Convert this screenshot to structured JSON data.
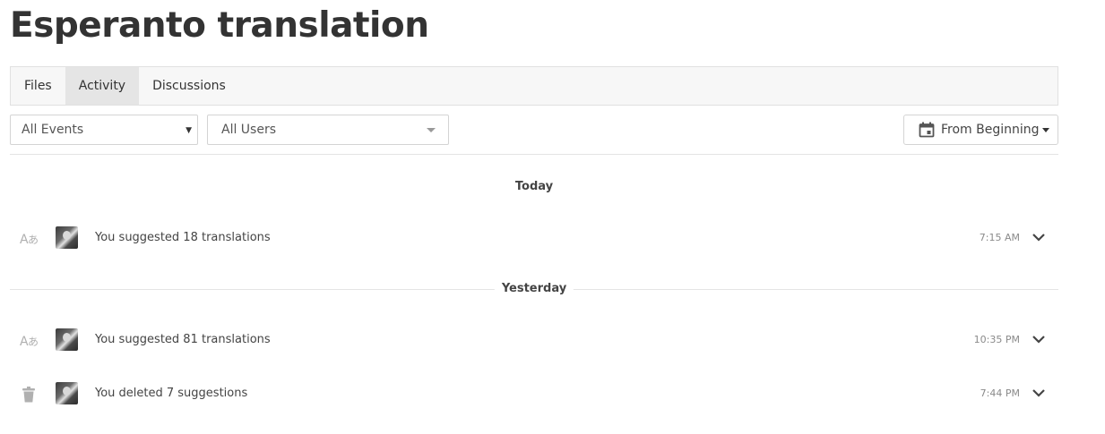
{
  "page": {
    "title": "Esperanto translation"
  },
  "tabs": [
    {
      "label": "Files",
      "active": false
    },
    {
      "label": "Activity",
      "active": true
    },
    {
      "label": "Discussions",
      "active": false
    }
  ],
  "filters": {
    "events": {
      "selected": "All Events",
      "icon": "caret-down-icon"
    },
    "users": {
      "selected": "All Users",
      "icon": "caret-down-icon"
    },
    "date": {
      "label": "From Beginning",
      "icon": "calendar-icon"
    }
  },
  "groups": [
    {
      "label": "Today",
      "events": [
        {
          "icon": "translate-icon",
          "text": "You suggested 18 translations",
          "time": "7:15 AM"
        }
      ]
    },
    {
      "label": "Yesterday",
      "events": [
        {
          "icon": "translate-icon",
          "text": "You suggested 81 translations",
          "time": "10:35 PM"
        },
        {
          "icon": "trash-icon",
          "text": "You deleted 7 suggestions",
          "time": "7:44 PM"
        }
      ]
    }
  ],
  "colors": {
    "tab_active_bg": "#e5e5e5",
    "tab_bar_bg": "#f7f7f7",
    "icon_gray": "#b0b0b0"
  }
}
